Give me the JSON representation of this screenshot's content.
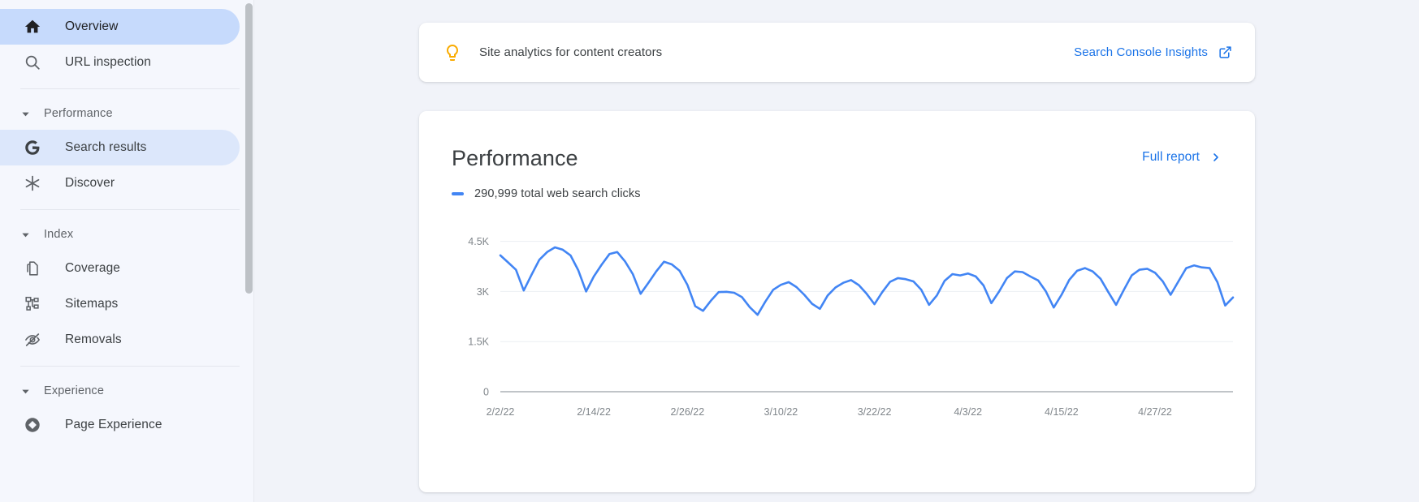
{
  "sidebar": {
    "items": [
      {
        "type": "item",
        "id": "overview",
        "label": "Overview",
        "icon": "home-icon",
        "state": "active-strong"
      },
      {
        "type": "item",
        "id": "url-inspection",
        "label": "URL inspection",
        "icon": "search-icon",
        "state": "none"
      },
      {
        "type": "divider"
      },
      {
        "type": "group",
        "id": "performance",
        "label": "Performance",
        "icon": "caret-down-icon"
      },
      {
        "type": "item",
        "id": "search-results",
        "label": "Search results",
        "icon": "google-g-icon",
        "state": "active-soft"
      },
      {
        "type": "item",
        "id": "discover",
        "label": "Discover",
        "icon": "discover-icon",
        "state": "none"
      },
      {
        "type": "divider"
      },
      {
        "type": "group",
        "id": "index",
        "label": "Index",
        "icon": "caret-down-icon"
      },
      {
        "type": "item",
        "id": "coverage",
        "label": "Coverage",
        "icon": "pages-icon",
        "state": "none"
      },
      {
        "type": "item",
        "id": "sitemaps",
        "label": "Sitemaps",
        "icon": "sitemap-icon",
        "state": "none"
      },
      {
        "type": "item",
        "id": "removals",
        "label": "Removals",
        "icon": "eye-off-icon",
        "state": "none"
      },
      {
        "type": "divider"
      },
      {
        "type": "group",
        "id": "experience",
        "label": "Experience",
        "icon": "caret-down-icon"
      },
      {
        "type": "item",
        "id": "page-experience",
        "label": "Page Experience",
        "icon": "page-experience-icon",
        "state": "none"
      }
    ],
    "scrollbar": {
      "name": "sidebar-scrollbar"
    }
  },
  "banner": {
    "icon": "lightbulb-icon",
    "text": "Site analytics for content creators",
    "link_label": "Search Console Insights",
    "link_icon": "external-link-icon"
  },
  "performance": {
    "title": "Performance",
    "full_report_label": "Full report",
    "full_report_icon": "chevron-right-icon",
    "legend_label": "290,999 total web search clicks",
    "legend_color": "#4285f4"
  },
  "colors": {
    "accent_blue": "#1a73e8",
    "line_blue": "#4285f4",
    "active_strong": "#c6dafc",
    "active_soft": "#dce7fb",
    "sidebar_bg": "#f5f7fd",
    "page_bg": "#f1f3f9",
    "bulb_yellow": "#f9ab00",
    "text_primary": "#3c4043",
    "text_secondary": "#5f6368",
    "tick_text": "#80868b"
  },
  "chart_data": {
    "type": "line",
    "title": "Performance",
    "series_name": "Total web search clicks",
    "total_label": "290,999 total web search clicks",
    "total_value": 290999,
    "xlabel": "",
    "ylabel": "",
    "ylim": [
      0,
      5000
    ],
    "y_ticks": [
      0,
      1500,
      3000,
      4500
    ],
    "y_tick_labels": [
      "0",
      "1.5K",
      "3K",
      "4.5K"
    ],
    "grid": true,
    "legend_position": "top-left",
    "x_tick_labels": [
      "2/2/22",
      "2/14/22",
      "2/26/22",
      "3/10/22",
      "3/22/22",
      "4/3/22",
      "4/15/22",
      "4/27/22"
    ],
    "x_tick_indices": [
      0,
      12,
      24,
      36,
      48,
      60,
      72,
      84
    ],
    "x_start": "2/2/22",
    "x_end": "5/2/22",
    "values": [
      4080,
      3870,
      3650,
      3030,
      3500,
      3950,
      4180,
      4320,
      4250,
      4080,
      3630,
      3000,
      3450,
      3800,
      4120,
      4180,
      3900,
      3520,
      2930,
      3260,
      3600,
      3890,
      3810,
      3620,
      3200,
      2560,
      2420,
      2720,
      2980,
      2990,
      2960,
      2830,
      2530,
      2300,
      2700,
      3050,
      3200,
      3280,
      3130,
      2900,
      2630,
      2480,
      2880,
      3120,
      3260,
      3340,
      3190,
      2930,
      2620,
      2980,
      3290,
      3400,
      3370,
      3300,
      3050,
      2600,
      2880,
      3320,
      3520,
      3480,
      3540,
      3450,
      3180,
      2650,
      3000,
      3400,
      3600,
      3580,
      3450,
      3330,
      3000,
      2520,
      2900,
      3350,
      3620,
      3700,
      3600,
      3380,
      2980,
      2600,
      3050,
      3480,
      3650,
      3680,
      3560,
      3300,
      2900,
      3300,
      3700,
      3780,
      3720,
      3700,
      3280,
      2580,
      2820
    ]
  }
}
